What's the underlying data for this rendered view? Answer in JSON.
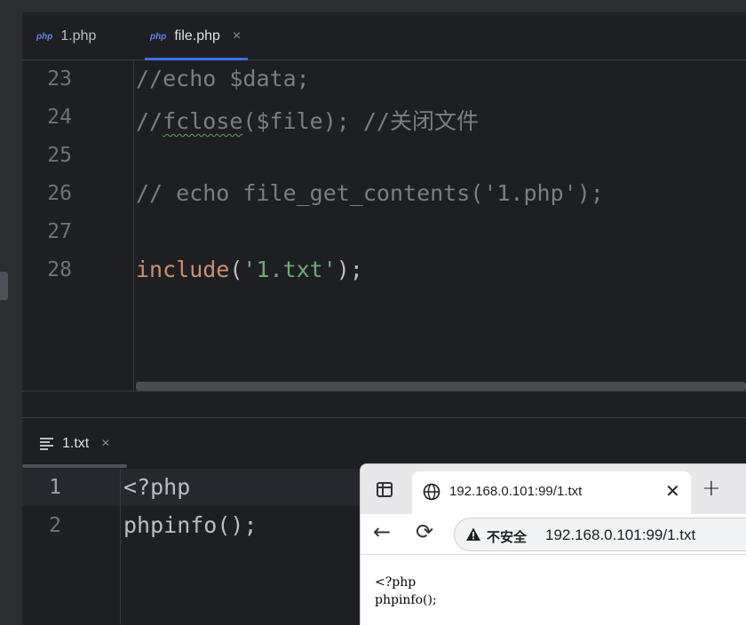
{
  "editor": {
    "tabs": [
      {
        "label": "1.php",
        "icon": "php"
      },
      {
        "label": "file.php",
        "icon": "php",
        "close": "×"
      }
    ],
    "lines": [
      {
        "number": "23",
        "code": "//echo $data;"
      },
      {
        "number": "24",
        "comment_prefix": "//",
        "squiggle": "fclose",
        "rest": "($file); //关闭文件"
      },
      {
        "number": "25",
        "code": ""
      },
      {
        "number": "26",
        "code": "// echo file_get_contents('1.php');"
      },
      {
        "number": "27",
        "code": ""
      },
      {
        "number": "28",
        "keyword": "include",
        "open": "(",
        "string": "'1.txt'",
        "close": ");"
      }
    ]
  },
  "editor2": {
    "tab": {
      "label": "1.txt",
      "close": "×"
    },
    "lines": [
      {
        "number": "1",
        "code": "<?php"
      },
      {
        "number": "2",
        "code": "phpinfo();"
      }
    ]
  },
  "browser": {
    "tab_title": "192.168.0.101:99/1.txt",
    "tab_close": "✕",
    "new_tab": "+",
    "back": "←",
    "reload": "⟳",
    "security_label": "不安全",
    "url": "192.168.0.101:99/1.txt",
    "content": [
      "<?php",
      "phpinfo();"
    ]
  },
  "colors": {
    "background": "#1e1f22",
    "keyword": "#cf8e6d",
    "string": "#6aab73",
    "comment": "#7a7e85",
    "accent": "#3574f0"
  }
}
